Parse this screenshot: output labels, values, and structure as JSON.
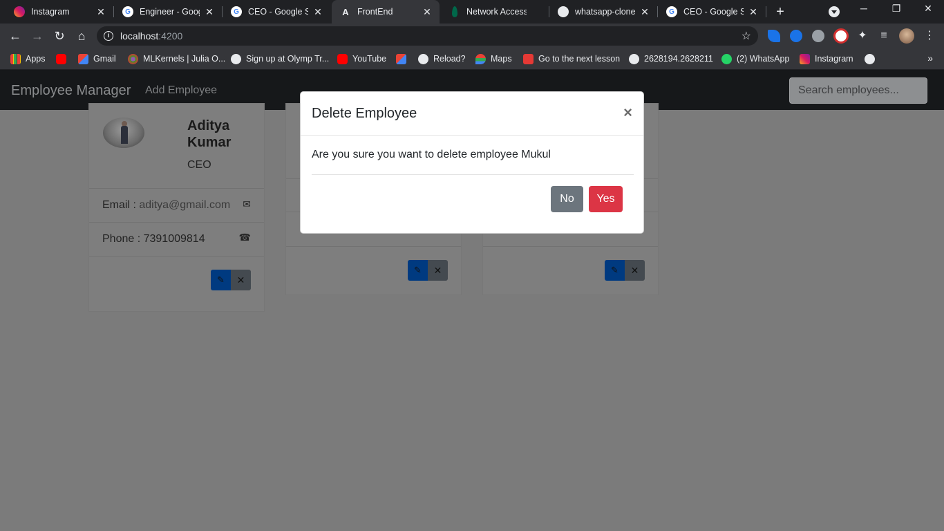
{
  "browser": {
    "tabs": [
      {
        "title": "Instagram",
        "active": false
      },
      {
        "title": "Engineer - Google",
        "active": false
      },
      {
        "title": "CEO - Google Sea",
        "active": false
      },
      {
        "title": "FrontEnd",
        "active": true
      },
      {
        "title": "Network Access |",
        "active": false
      },
      {
        "title": "whatsapp-clone/f",
        "active": false
      },
      {
        "title": "CEO - Google Sea",
        "active": false
      }
    ],
    "new_tab": "+",
    "url_host": "localhost",
    "url_port": ":4200",
    "bookmarks": [
      {
        "label": "Apps"
      },
      {
        "label": ""
      },
      {
        "label": "Gmail"
      },
      {
        "label": "MLKernels | Julia O..."
      },
      {
        "label": "Sign up at Olymp Tr..."
      },
      {
        "label": "YouTube"
      },
      {
        "label": ""
      },
      {
        "label": "Reload?"
      },
      {
        "label": "Maps"
      },
      {
        "label": "Go to the next lesson"
      },
      {
        "label": "2628194.2628211"
      },
      {
        "label": "(2) WhatsApp"
      },
      {
        "label": "Instagram"
      },
      {
        "label": ""
      }
    ],
    "bookmarks_more": "»"
  },
  "app": {
    "brand": "Employee Manager",
    "add_link": "Add Employee",
    "search_placeholder": "Search employees..."
  },
  "employees": [
    {
      "name": "Aditya Kumar",
      "job": "CEO",
      "email_label": "Email : ",
      "email": "aditya@gmail.com",
      "phone_label": "Phone : ",
      "phone": "7391009814"
    }
  ],
  "modal": {
    "title": "Delete Employee",
    "close": "×",
    "message": "Are you sure you want to delete employee Mukul",
    "no_label": "No",
    "yes_label": "Yes"
  },
  "colors": {
    "modal_yes": "#dc3545",
    "modal_no": "#6c757d",
    "edit_button": "#003a80",
    "backdrop": "#7b7b7b"
  }
}
